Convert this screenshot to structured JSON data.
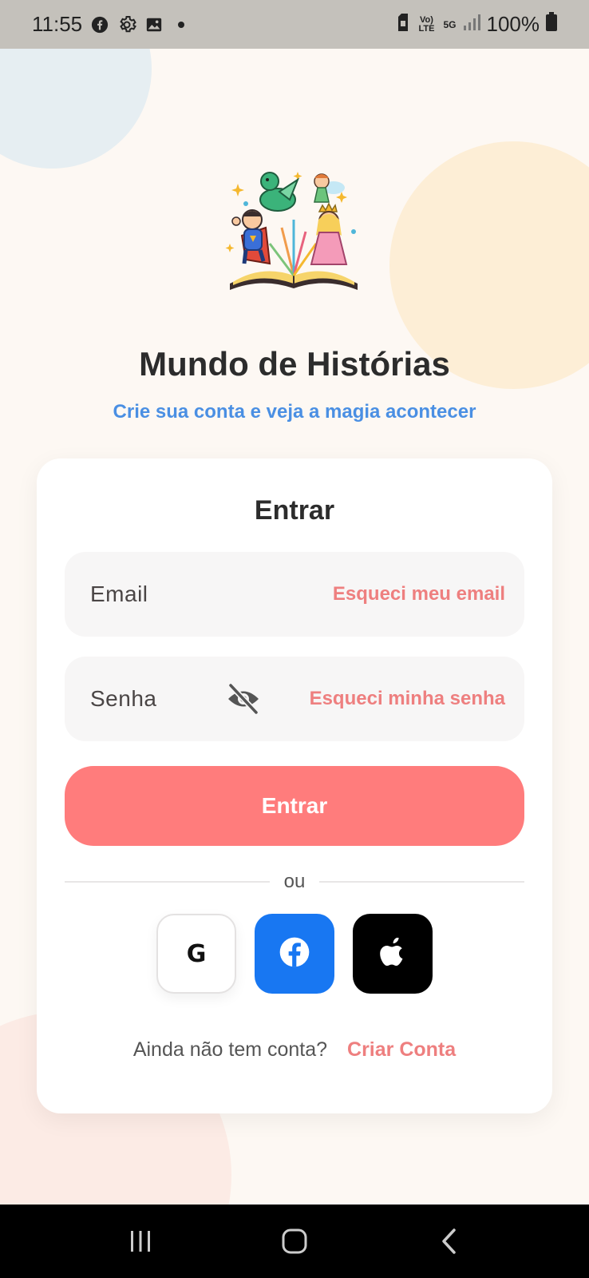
{
  "status_bar": {
    "time": "11:55",
    "battery": "100%",
    "net_volte": "Vo) LTE",
    "net_5g": "5G"
  },
  "header": {
    "title": "Mundo de Histórias",
    "subtitle": "Crie sua conta e veja a magia acontecer"
  },
  "login": {
    "title": "Entrar",
    "email_label": "Email",
    "forgot_email": "Esqueci meu email",
    "password_label": "Senha",
    "forgot_password": "Esqueci minha senha",
    "submit_label": "Entrar",
    "divider_text": "ou",
    "google_label": "G",
    "signup_prompt": "Ainda não tem conta?",
    "signup_link": "Criar Conta"
  },
  "colors": {
    "accent": "#ff7c7c",
    "link": "#ee7f7f",
    "subtitle": "#4a8fe3",
    "facebook": "#1877f2",
    "apple": "#000000"
  },
  "icons": {
    "status": [
      "facebook-icon",
      "settings-icon",
      "gallery-icon",
      "dot-icon"
    ],
    "password_toggle": "eye-off-icon",
    "social": [
      "google-icon",
      "facebook-icon",
      "apple-icon"
    ],
    "nav": [
      "recent-apps-icon",
      "home-icon",
      "back-icon"
    ]
  }
}
